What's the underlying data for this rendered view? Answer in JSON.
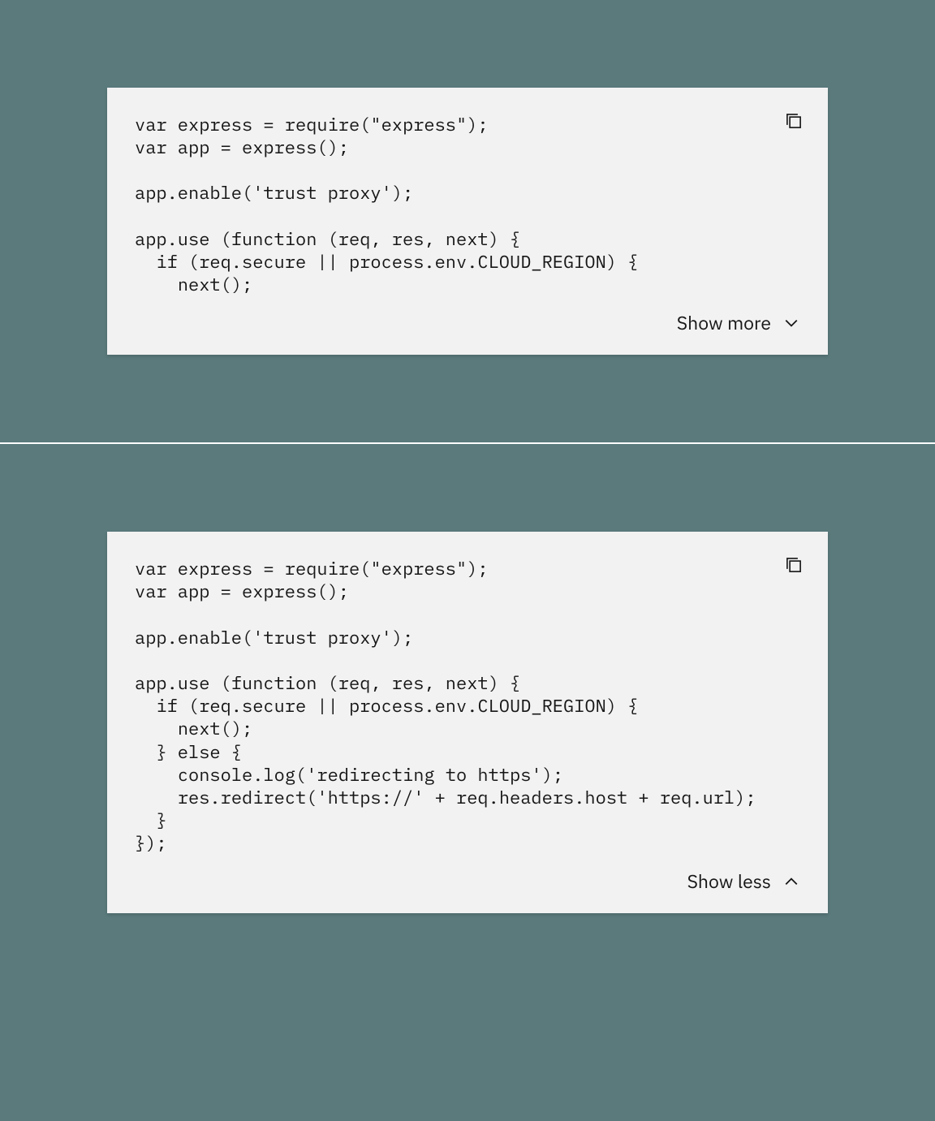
{
  "blocks": [
    {
      "code": "var express = require(\"express\");\nvar app = express();\n\napp.enable('trust proxy');\n\napp.use (function (req, res, next) {\n  if (req.secure || process.env.CLOUD_REGION) {\n    next();",
      "toggle_label": "Show more",
      "toggle_direction": "down"
    },
    {
      "code": "var express = require(\"express\");\nvar app = express();\n\napp.enable('trust proxy');\n\napp.use (function (req, res, next) {\n  if (req.secure || process.env.CLOUD_REGION) {\n    next();\n  } else {\n    console.log('redirecting to https');\n    res.redirect('https://' + req.headers.host + req.url);\n  }\n});",
      "toggle_label": "Show less",
      "toggle_direction": "up"
    }
  ]
}
